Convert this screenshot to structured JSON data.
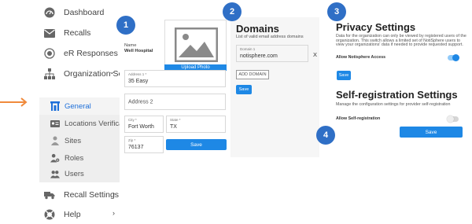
{
  "sidebar": {
    "items": [
      {
        "label": "Dashboard",
        "icon": "dashboard-icon"
      },
      {
        "label": "Recalls",
        "icon": "envelope-icon"
      },
      {
        "label": "eR Responses",
        "icon": "target-icon"
      },
      {
        "label": "Organization Se",
        "icon": "org-chart-icon",
        "chevron": "⌄"
      }
    ],
    "sub_items": [
      {
        "label": "General",
        "icon": "building-icon",
        "active": true
      },
      {
        "label": "Locations Verifica",
        "icon": "id-card-icon"
      },
      {
        "label": "Sites",
        "icon": "person-icon"
      },
      {
        "label": "Roles",
        "icon": "person-gear-icon"
      },
      {
        "label": "Users",
        "icon": "people-icon"
      }
    ],
    "bottom_items": [
      {
        "label": "Recall Settings",
        "icon": "truck-icon",
        "chevron": "›"
      },
      {
        "label": "Help",
        "icon": "help-icon",
        "chevron": "›"
      }
    ]
  },
  "panel1": {
    "badge": "1",
    "name_label": "Name",
    "name_value": "Well Hospital",
    "upload_label": "Upload Photo",
    "address1_label": "Address 1 *",
    "address1_value": "35 Easy",
    "address2_placeholder": "Address 2",
    "city_label": "City *",
    "city_value": "Fort Worth",
    "state_label": "State *",
    "state_value": "TX",
    "zip_label": "Zip *",
    "zip_value": "76137",
    "save_label": "Save"
  },
  "panel2": {
    "badge": "2",
    "title": "Domains",
    "description": "List of valid email address domains",
    "domain_label": "Domain 1",
    "domain_value": "notisphere.com",
    "remove_label": "X",
    "add_label": "ADD DOMAIN",
    "save_label": "Save"
  },
  "panel3": {
    "badge": "3",
    "title": "Privacy Settings",
    "description": "Data for the organization can only be viewed by registered users of the organization. This switch allows a limited set of NotiSphere users to view your organizations' data if needed to provide requested support.",
    "toggle_label": "Allow Notisphere Access",
    "toggle_on": true,
    "save_label": "Save"
  },
  "panel4": {
    "badge": "4",
    "title": "Self-registration Settings",
    "description": "Manage the configuration settings for provider self-registration",
    "toggle_label": "Allow Self-registration",
    "toggle_on": false,
    "save_label": "Save"
  },
  "colors": {
    "accent": "#1e88e5",
    "badge": "#2f6fc6",
    "arrow": "#f08a3c",
    "active_nav": "#1e6fd9"
  }
}
